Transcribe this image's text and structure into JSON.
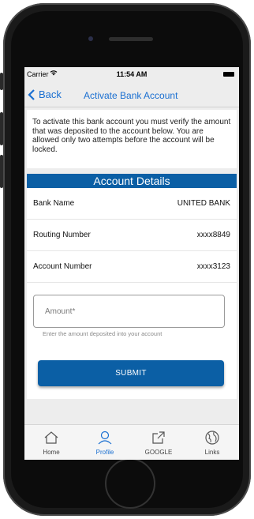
{
  "status": {
    "carrier": "Carrier",
    "time": "11:54 AM"
  },
  "nav": {
    "back_label": "Back",
    "title": "Activate Bank Account"
  },
  "notice": "To activate this bank account you must verify the amount that was deposited to the account below. You are allowed only two attempts before the account will be locked.",
  "account": {
    "header": "Account Details",
    "rows": [
      {
        "label": "Bank Name",
        "value": "UNITED BANK"
      },
      {
        "label": "Routing Number",
        "value": "xxxx8849"
      },
      {
        "label": "Account Number",
        "value": "xxxx3123"
      }
    ]
  },
  "amount": {
    "placeholder": "Amount*",
    "helper": "Enter the amount deposited into your account"
  },
  "submit_label": "SUBMIT",
  "tabs": [
    {
      "label": "Home",
      "icon": "home-icon"
    },
    {
      "label": "Profile",
      "icon": "profile-icon",
      "active": true
    },
    {
      "label": "GOOGLE",
      "icon": "external-link-icon"
    },
    {
      "label": "Links",
      "icon": "globe-icon"
    }
  ],
  "colors": {
    "primary": "#0b5fa5",
    "link": "#1a6fd1",
    "background": "#ededed"
  }
}
